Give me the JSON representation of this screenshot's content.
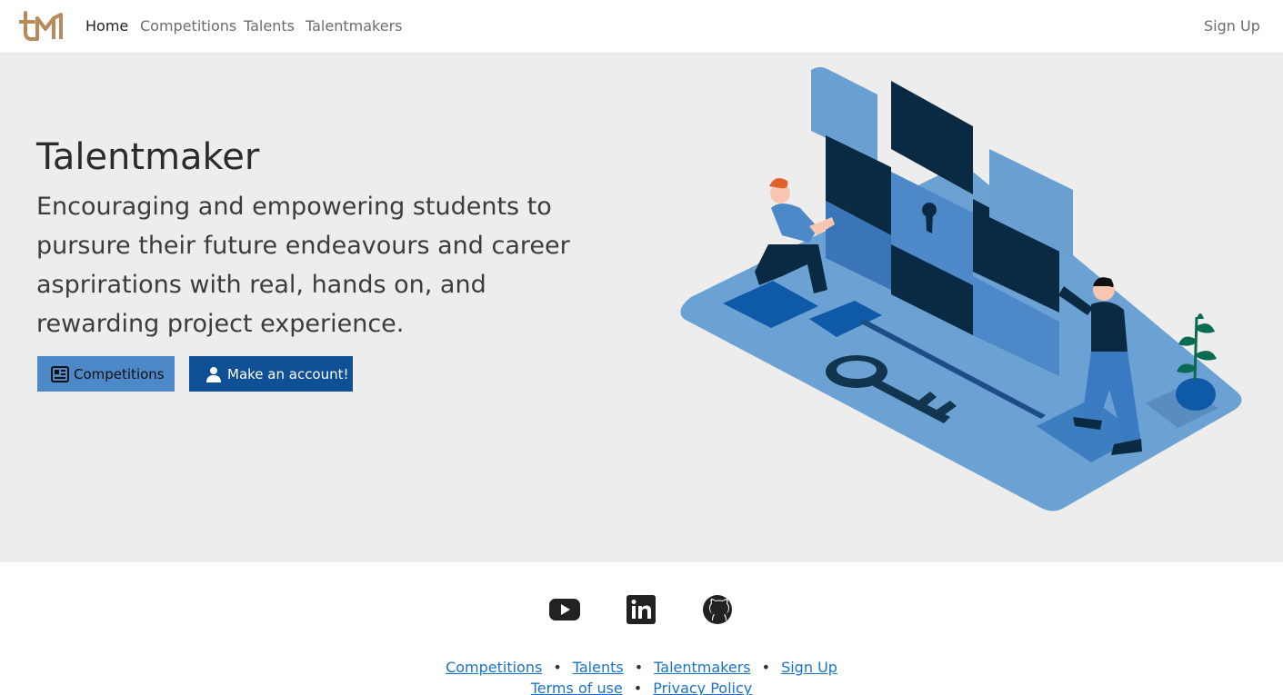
{
  "brand": {
    "logo_text": "tM"
  },
  "nav": {
    "home": "Home",
    "competitions": "Competitions",
    "talents": "Talents",
    "talentmakers": "Talentmakers",
    "signup": "Sign Up"
  },
  "hero": {
    "title": "Talentmaker",
    "subtitle": "Encouraging and empowering students to pursure their future endeavours and career asprirations with real, hands on, and rewarding project experience.",
    "btn_competitions": "Competitions",
    "btn_account": "Make an account!"
  },
  "footer": {
    "links_row1": [
      "Competitions",
      "Talents",
      "Talentmakers",
      "Sign Up"
    ],
    "links_row2": [
      "Terms of use",
      "Privacy Policy"
    ],
    "separator": "•"
  },
  "icons": {
    "youtube": "youtube-icon",
    "linkedin": "linkedin-icon",
    "github": "github-icon",
    "competitions": "newspaper-icon",
    "account": "person-icon"
  },
  "colors": {
    "brand": "#b98a5c",
    "hero_bg": "#ededed",
    "btn_light": "#4d88c8",
    "btn_dark": "#0e4f96",
    "link": "#1a73c9"
  }
}
